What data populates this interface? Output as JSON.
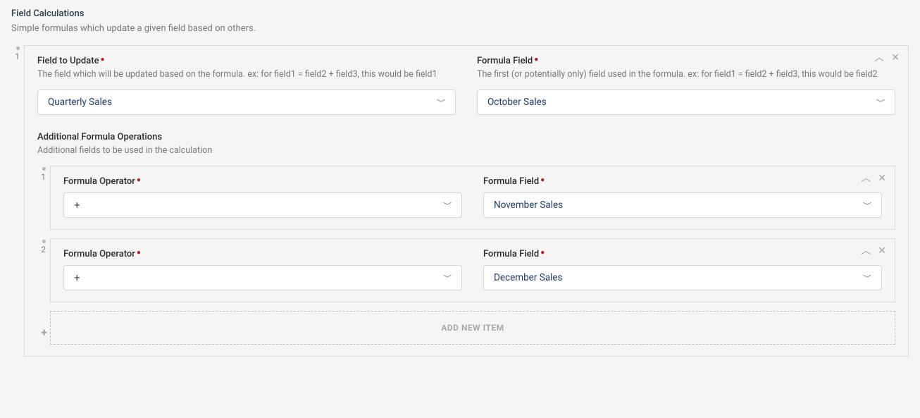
{
  "section": {
    "title": "Field Calculations",
    "desc": "Simple formulas which update a given field based on others."
  },
  "mainPanel": {
    "index": "1",
    "fieldToUpdate": {
      "label": "Field to Update",
      "help": "The field which will be updated based on the formula. ex: for field1 = field2 + field3, this would be field1",
      "value": "Quarterly Sales"
    },
    "formulaField": {
      "label": "Formula Field",
      "help": "The first (or potentially only) field used in the formula. ex: for field1 = field2 + field3, this would be field2",
      "value": "October Sales"
    },
    "additional": {
      "title": "Additional Formula Operations",
      "desc": "Additional fields to be used in the calculation"
    }
  },
  "ops": [
    {
      "index": "1",
      "operatorLabel": "Formula Operator",
      "operatorValue": "+",
      "fieldLabel": "Formula Field",
      "fieldValue": "November Sales"
    },
    {
      "index": "2",
      "operatorLabel": "Formula Operator",
      "operatorValue": "+",
      "fieldLabel": "Formula Field",
      "fieldValue": "December Sales"
    }
  ],
  "addItem": "ADD NEW ITEM"
}
